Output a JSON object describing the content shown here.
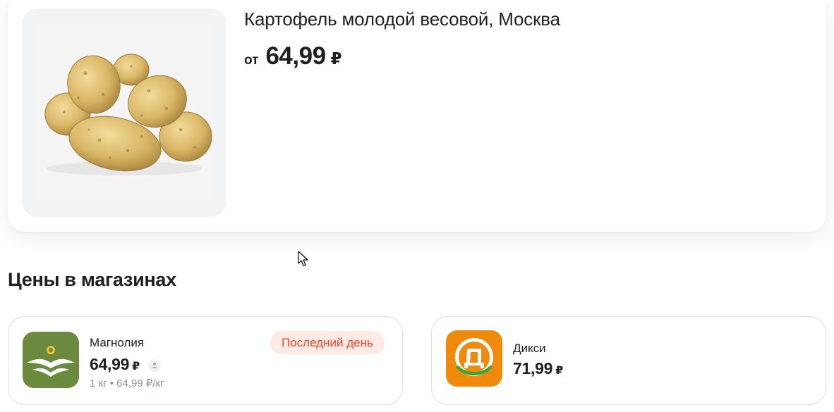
{
  "product": {
    "title": "Картофель молодой весовой, Москва",
    "price_prefix": "от",
    "price": "64,99",
    "currency": "₽"
  },
  "icons": {
    "product_image": "potatoes-photo",
    "cursor": "mouse-pointer-icon",
    "user": "user-icon"
  },
  "section": {
    "heading": "Цены в магазинах"
  },
  "stores": [
    {
      "name": "Магнолия",
      "price": "64,99",
      "currency": "₽",
      "unit_price": "1 кг • 64,99 ₽/кг",
      "badge": "Последний день",
      "logo": "magnolia-logo",
      "logo_color": "#6b8a3e"
    },
    {
      "name": "Дикси",
      "price": "71,99",
      "currency": "₽",
      "logo": "dixy-logo",
      "logo_color": "#f08a0c"
    }
  ],
  "colors": {
    "badge_bg": "#ffeae6",
    "badge_text": "#ee4828",
    "muted_text": "#8a9096"
  }
}
